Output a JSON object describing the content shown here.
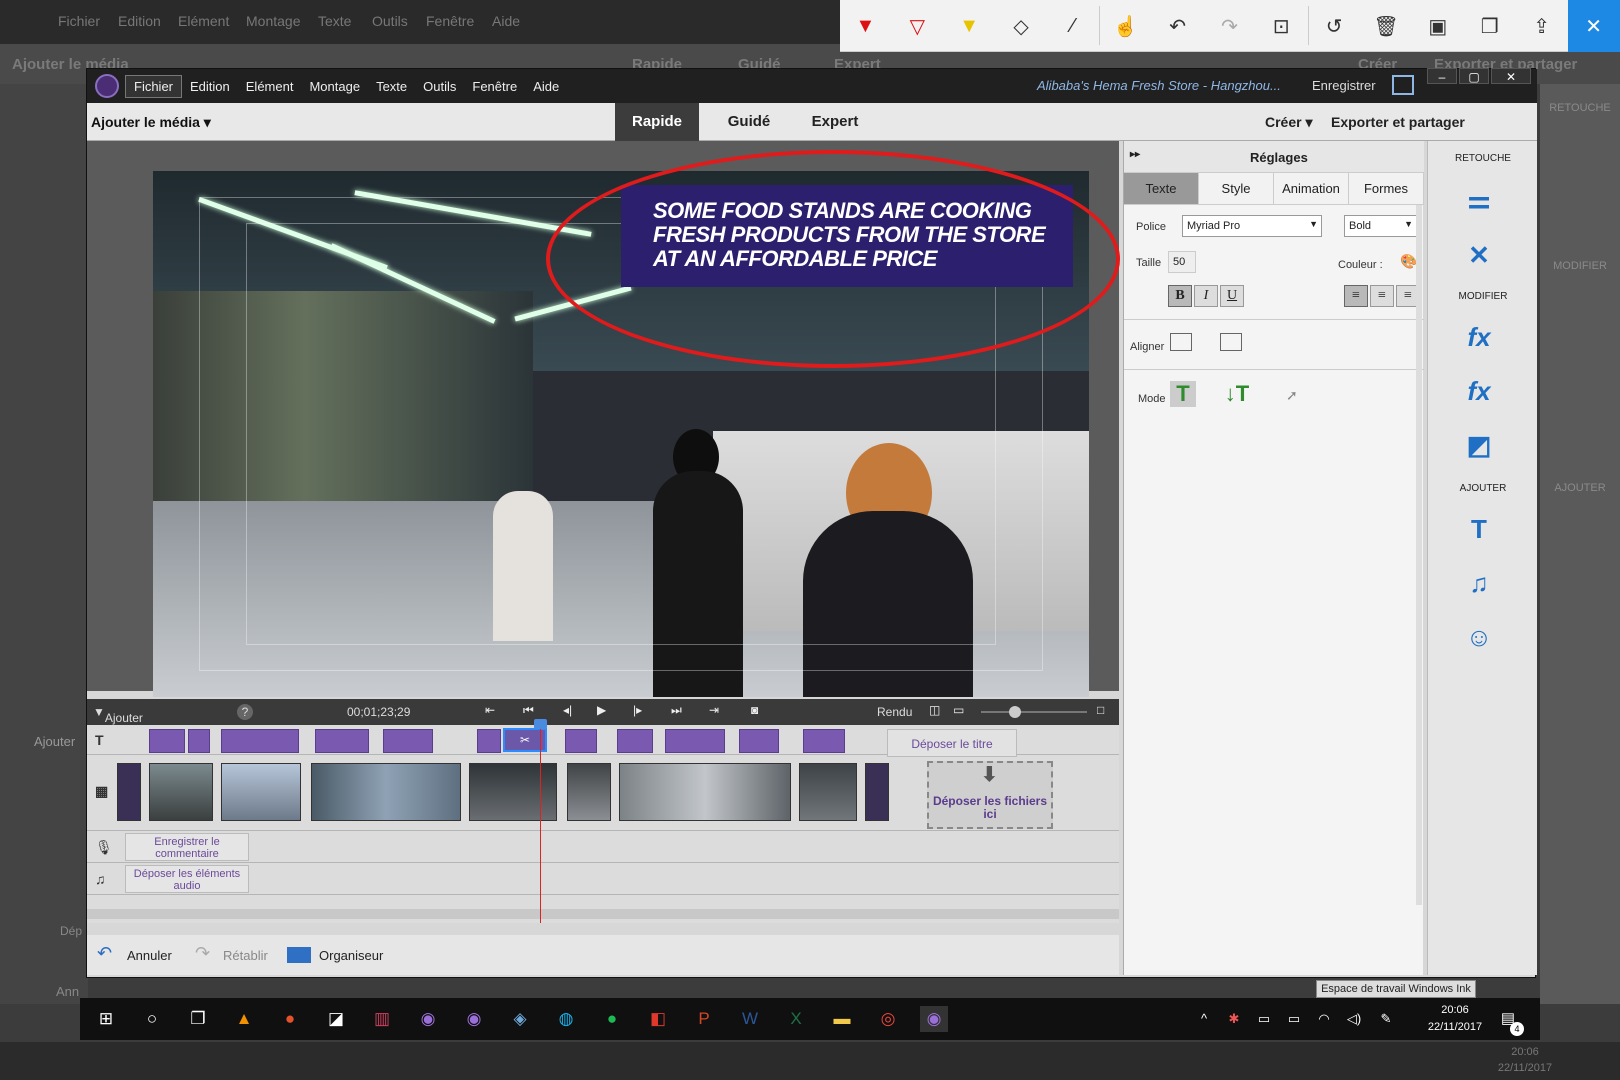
{
  "background_app": {
    "menu": [
      "Fichier",
      "Edition",
      "Elément",
      "Montage",
      "Texte",
      "Outils",
      "Fenêtre",
      "Aide"
    ],
    "add_media": "Ajouter le média",
    "tabs": [
      "Rapide",
      "Guidé",
      "Expert"
    ],
    "create": "Créer",
    "export": "Exporter et partager",
    "retouche": "RETOUCHE",
    "modifier": "MODIFIER",
    "ajouter": "AJOUTER",
    "add_marker": "Ajouter",
    "cancel": "Ann",
    "drop": "Dép",
    "time": "20:06",
    "date": "22/11/2017"
  },
  "ink_toolbar": {
    "tools": [
      "ballpoint-pen-icon",
      "pencil-icon",
      "highlighter-icon",
      "eraser-icon",
      "ruler-icon",
      "touch-writing-icon",
      "undo-icon",
      "redo-icon",
      "crop-icon",
      "history-icon",
      "delete-icon",
      "save-icon",
      "copy-icon",
      "share-icon",
      "close-icon"
    ],
    "accent": "#1e88e5"
  },
  "window": {
    "menu": [
      "Fichier",
      "Edition",
      "Elément",
      "Montage",
      "Texte",
      "Outils",
      "Fenêtre",
      "Aide"
    ],
    "document_title": "Alibaba's Hema Fresh Store - Hangzhou...",
    "save": "Enregistrer"
  },
  "modebar": {
    "add_media": "Ajouter le média",
    "tabs": [
      "Rapide",
      "Guidé",
      "Expert"
    ],
    "active_tab": "Rapide",
    "create": "Créer",
    "export": "Exporter et partager"
  },
  "caption": {
    "lines": [
      "SOME FOOD STANDS ARE COOKING",
      "FRESH PRODUCTS FROM THE STORE",
      "AT AN AFFORDABLE PRICE"
    ],
    "bg_color": "#2c1f6e",
    "annotation_color": "#e01b1b"
  },
  "transport": {
    "add_marker": "Ajouter une marque",
    "help": "?",
    "timecode": "00;01;23;29",
    "render": "Rendu"
  },
  "timeline": {
    "drop_title": "Déposer le titre",
    "drop_files": "Déposer les fichiers ici",
    "record_comment": "Enregistrer le commentaire",
    "drop_audio": "Déposer les éléments audio"
  },
  "bottom": {
    "undo": "Annuler",
    "redo": "Rétablir",
    "organizer": "Organiseur"
  },
  "panel": {
    "title": "Réglages",
    "tabs": [
      "Texte",
      "Style",
      "Animation",
      "Formes"
    ],
    "active_tab": "Texte",
    "font_label": "Police",
    "font_value": "Myriad Pro",
    "weight_value": "Bold",
    "size_label": "Taille",
    "size_value": "50",
    "color_label": "Couleur :",
    "bold": "B",
    "italic": "I",
    "underline": "U",
    "align_label": "Aligner",
    "mode_label": "Mode"
  },
  "tools": {
    "retouche": "RETOUCHE",
    "modifier": "MODIFIER",
    "ajouter": "AJOUTER"
  },
  "tooltip": "Espace de travail Windows Ink",
  "taskbar": {
    "time": "20:06",
    "date": "22/11/2017",
    "notifications": "4"
  }
}
